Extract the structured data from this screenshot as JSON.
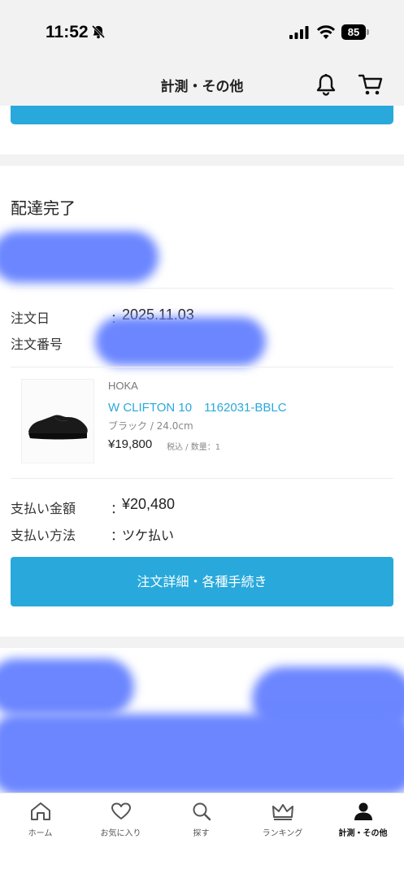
{
  "status_bar": {
    "time": "11:52",
    "battery": "85"
  },
  "header": {
    "title": "計測・その他",
    "bell_icon": "bell-icon",
    "cart_icon": "cart-icon"
  },
  "order": {
    "status": "配達完了",
    "date_label": "注文日",
    "date_value": "2025.11.03",
    "number_label": "注文番号",
    "colon": "：",
    "product": {
      "brand": "HOKA",
      "name": "W CLIFTON 10　1162031-BBLC",
      "variant": "ブラック / 24.0cm",
      "price": "¥19,800",
      "price_note": "税込 / 数量：1"
    },
    "payment_amount_label": "支払い金額",
    "payment_amount_value": "¥20,480",
    "payment_method_label": "支払い方法",
    "payment_method_value": "ツケ払い",
    "detail_button": "注文詳細・各種手続き"
  },
  "nav": {
    "items": [
      {
        "label": "ホーム",
        "icon": "home-icon"
      },
      {
        "label": "お気に入り",
        "icon": "heart-icon"
      },
      {
        "label": "探す",
        "icon": "search-icon"
      },
      {
        "label": "ランキング",
        "icon": "crown-icon"
      },
      {
        "label": "計測・その他",
        "icon": "person-icon",
        "active": true
      }
    ]
  },
  "colors": {
    "accent": "#29a9db",
    "redaction": "#6b86ff",
    "background_gray": "#f2f2f2"
  }
}
